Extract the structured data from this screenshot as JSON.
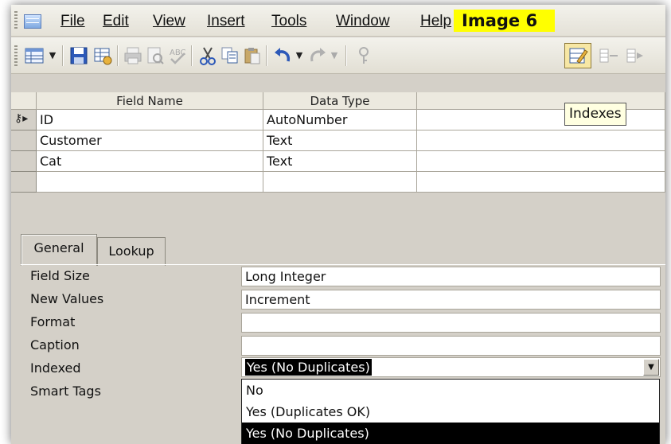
{
  "menu": {
    "items": [
      {
        "label": "File"
      },
      {
        "label": "Edit"
      },
      {
        "label": "View"
      },
      {
        "label": "Insert"
      },
      {
        "label": "Tools"
      },
      {
        "label": "Window"
      },
      {
        "label": "Help"
      }
    ]
  },
  "image_tag": "Image 6",
  "toolbar": {
    "icons": [
      "view-icon",
      "save-icon",
      "table-icon",
      "print-icon",
      "print-preview-icon",
      "spelling-icon",
      "cut-icon",
      "copy-icon",
      "paste-icon",
      "undo-icon",
      "redo-icon",
      "primary-key-icon",
      "indexes-icon",
      "insert-rows-icon",
      "delete-rows-icon"
    ]
  },
  "tooltip": "Indexes",
  "field_grid": {
    "headers": [
      "Field Name",
      "Data Type"
    ],
    "rows": [
      {
        "field": "ID",
        "type": "AutoNumber",
        "key": true
      },
      {
        "field": "Customer",
        "type": "Text"
      },
      {
        "field": "Cat",
        "type": "Text"
      },
      {
        "field": "",
        "type": ""
      }
    ]
  },
  "tabs": [
    {
      "label": "General",
      "active": true
    },
    {
      "label": "Lookup",
      "active": false
    }
  ],
  "properties": [
    {
      "label": "Field Size",
      "value": "Long Integer"
    },
    {
      "label": "New Values",
      "value": "Increment"
    },
    {
      "label": "Format",
      "value": ""
    },
    {
      "label": "Caption",
      "value": ""
    },
    {
      "label": "Indexed",
      "value": "Yes (No Duplicates)"
    },
    {
      "label": "Smart Tags",
      "value": ""
    }
  ],
  "indexed_dropdown": {
    "options": [
      "No",
      "Yes (Duplicates OK)",
      "Yes (No Duplicates)"
    ],
    "selected": "Yes (No Duplicates)"
  },
  "colors": {
    "tag_highlight": "#ffff00",
    "window_face": "#d4d0c8",
    "tooltip_bg": "#ffffe1",
    "selection": "#000000"
  }
}
